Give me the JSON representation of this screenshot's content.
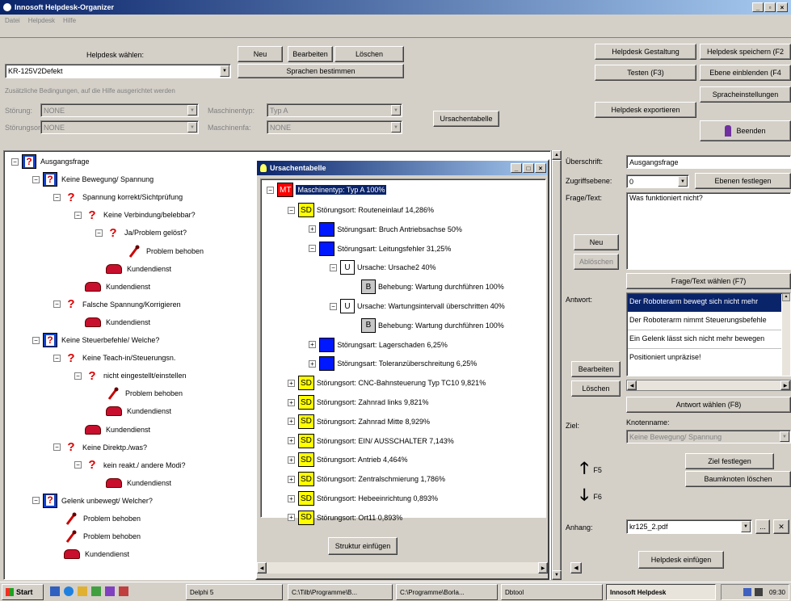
{
  "window": {
    "title": "Innosoft Helpdesk-Organizer"
  },
  "menu": [
    "Datei",
    "Helpdesk",
    "Hilfe"
  ],
  "top": {
    "helpdesk_label": "Helpdesk wählen:",
    "helpdesk_value": "KR-125V2Defekt",
    "neu": "Neu",
    "bearbeiten": "Bearbeiten",
    "loeschen": "Löschen",
    "sprachen": "Sprachen bestimmen",
    "conditions_label": "Zusätzliche Bedingungen, auf die Hilfe ausgerichtet werden",
    "storung_label": "Störung:",
    "storung_value": "NONE",
    "maschinentyp_label": "Maschinentyp:",
    "maschinentyp_value": "Typ A",
    "storungsort_label": "Störungsort:",
    "storungsort_value": "NONE",
    "maschinenfa_label": "Maschinenfa:",
    "maschinenfa_value": "NONE",
    "ursachentabelle": "Ursachentabelle",
    "gestaltung": "Helpdesk Gestaltung",
    "speichern": "Helpdesk speichern (F2",
    "testen": "Testen (F3)",
    "ebene": "Ebene einblenden (F4",
    "spracheinst": "Spracheinstellungen",
    "exportieren": "Helpdesk exportieren",
    "beenden": "Beenden"
  },
  "tree": [
    {
      "label": "Ausgangsfrage",
      "icon": "question-box-icon"
    },
    {
      "label": "Keine Bewegung/ Spannung",
      "icon": "question-box-icon"
    },
    {
      "label": "Spannung korrekt/Sichtprüfung",
      "icon": "question-icon"
    },
    {
      "label": "Keine Verbindung/belebbar?",
      "icon": "question-icon"
    },
    {
      "label": "Ja/Problem gelöst?",
      "icon": "question-icon"
    },
    {
      "label": "Problem behoben",
      "icon": "tool-icon"
    },
    {
      "label": "Kundendienst",
      "icon": "phone-icon"
    },
    {
      "label": "Kundendienst",
      "icon": "phone-icon"
    },
    {
      "label": "Falsche Spannung/Korrigieren",
      "icon": "question-icon"
    },
    {
      "label": "Kundendienst",
      "icon": "phone-icon"
    },
    {
      "label": "Keine Steuerbefehle/ Welche?",
      "icon": "question-box-icon"
    },
    {
      "label": "Keine Teach-in/Steuerungsn.",
      "icon": "question-icon"
    },
    {
      "label": "nicht eingestellt/einstellen",
      "icon": "question-icon"
    },
    {
      "label": "Problem behoben",
      "icon": "tool-icon"
    },
    {
      "label": "Kundendienst",
      "icon": "phone-icon"
    },
    {
      "label": "Kundendienst",
      "icon": "phone-icon"
    },
    {
      "label": "Keine Direktp./was?",
      "icon": "question-icon"
    },
    {
      "label": "kein reakt./ andere Modi?",
      "icon": "question-icon"
    },
    {
      "label": "Kundendienst",
      "icon": "phone-icon"
    },
    {
      "label": "Gelenk unbewegt/ Welcher?",
      "icon": "question-box-icon"
    },
    {
      "label": "Problem behoben",
      "icon": "tool-icon"
    },
    {
      "label": "Problem behoben",
      "icon": "tool-icon"
    },
    {
      "label": "Kundendienst",
      "icon": "phone-icon"
    }
  ],
  "dialog": {
    "title": "Ursachentabelle",
    "root": {
      "tag": "MT",
      "label": "Maschinentyp: Typ A 100%"
    },
    "nodes": [
      {
        "tag": "SD",
        "label": "Störungsort: Routeneinlauf 14,286%"
      },
      {
        "tag": "SA",
        "label": "Störungsart: Bruch Antriebsachse 50%"
      },
      {
        "tag": "SA",
        "label": "Störungsart: Leitungsfehler 31,25%"
      },
      {
        "tag": "U",
        "label": "Ursache: Ursache2 40%"
      },
      {
        "tag": "B",
        "label": "Behebung: Wartung durchführen 100%"
      },
      {
        "tag": "U",
        "label": "Ursache: Wartungsintervall überschritten 40%"
      },
      {
        "tag": "B",
        "label": "Behebung: Wartung durchführen 100%"
      },
      {
        "tag": "SA",
        "label": "Störungsart: Lagerschaden 6,25%"
      },
      {
        "tag": "SA",
        "label": "Störungsart: Toleranzüberschreitung 6,25%"
      },
      {
        "tag": "SD",
        "label": "Störungsort: CNC-Bahnsteuerung Typ TC10 9,821%"
      },
      {
        "tag": "SD",
        "label": "Störungsort: Zahnrad links 9,821%"
      },
      {
        "tag": "SD",
        "label": "Störungsort: Zahnrad Mitte 8,929%"
      },
      {
        "tag": "SD",
        "label": "Störungsort: EIN/ AUSSCHALTER 7,143%"
      },
      {
        "tag": "SD",
        "label": "Störungsort: Antrieb 4,464%"
      },
      {
        "tag": "SD",
        "label": "Störungsort: Zentralschmierung 1,786%"
      },
      {
        "tag": "SD",
        "label": "Störungsort: Hebeeinrichtung 0,893%"
      },
      {
        "tag": "SD",
        "label": "Störungsort: Ort11 0,893%"
      }
    ],
    "struktur": "Struktur einfügen"
  },
  "right": {
    "ueberschrift_label": "Überschrift:",
    "ueberschrift_value": "Ausgangsfrage",
    "zugriff_label": "Zugriffsebene:",
    "zugriff_value": "0",
    "ebenen": "Ebenen festlegen",
    "frage_label": "Frage/Text:",
    "frage_value": "Was funktioniert nicht?",
    "neu": "Neu",
    "abloeschen": "Ablöschen",
    "frage_waehlen": "Frage/Text wählen (F7)",
    "antwort_label": "Antwort:",
    "antworten": [
      "Der Roboterarm bewegt sich nicht mehr",
      "Der Roboterarm nimmt Steuerungsbefehle",
      "Ein Gelenk lässt sich nicht mehr bewegen",
      "Positioniert unpräzise!"
    ],
    "bearbeiten": "Bearbeiten",
    "loeschen": "Löschen",
    "antwort_waehlen": "Antwort wählen (F8)",
    "ziel_label": "Ziel:",
    "knotenname_label": "Knotenname:",
    "knotenname_value": "Keine Bewegung/ Spannung",
    "f5": "F5",
    "f6": "F6",
    "ziel_festlegen": "Ziel festlegen",
    "baum_loeschen": "Baumknoten löschen",
    "anhang_label": "Anhang:",
    "anhang_value": "kr125_2.pdf",
    "ellipsis": "...",
    "helpdesk_einfuegen": "Helpdesk einfügen"
  },
  "taskbar": {
    "start": "Start",
    "items": [
      "Delphi 5",
      "C:\\Tilb\\Programme\\B...",
      "C:\\Programme\\Borla...",
      "Dbtool",
      "Innosoft Helpdesk"
    ],
    "time": "09:30"
  }
}
